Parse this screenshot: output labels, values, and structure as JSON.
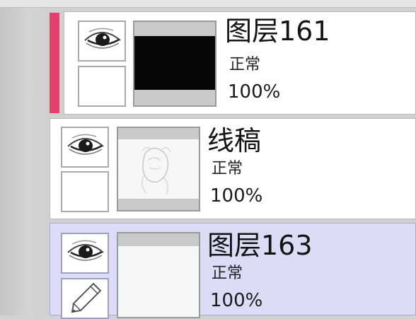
{
  "layers": [
    {
      "name": "图层161",
      "blend_mode": "正常",
      "opacity": "100%",
      "visible": true,
      "thumbnail": "black-fill",
      "marker_color": "#e2416d"
    },
    {
      "name": "线稿",
      "blend_mode": "正常",
      "opacity": "100%",
      "visible": true,
      "thumbnail": "line-art"
    },
    {
      "name": "图层163",
      "blend_mode": "正常",
      "opacity": "100%",
      "visible": true,
      "selected": true,
      "editing": true,
      "thumbnail": "white-fill"
    }
  ],
  "icons": {
    "visibility": "eye-icon",
    "edit": "pencil-icon"
  },
  "colors": {
    "selected_layer_bg": "#dcdcf6",
    "layer_bg": "#ffffff",
    "marker": "#e2416d"
  }
}
